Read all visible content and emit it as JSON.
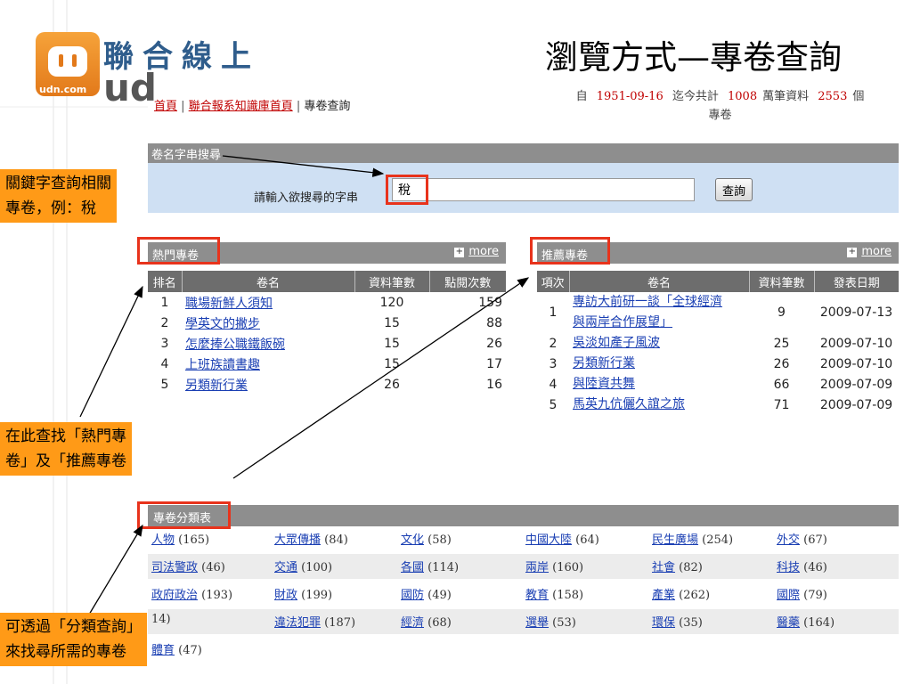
{
  "logo": {
    "text": "聯合線上",
    "com": "udn.com",
    "ud": "ud"
  },
  "slide_title": "瀏覽方式—專卷查詢",
  "breadcrumb": {
    "home": "首頁",
    "kb_home": "聯合報系知識庫首頁",
    "current": "專卷查詢",
    "sep": "|"
  },
  "stats": {
    "from_label": "自",
    "from_date": "1951-09-16",
    "total_label": "迄今共計",
    "records": "1008",
    "records_label": "萬筆資料",
    "volumes": "2553",
    "volumes_label": "個",
    "line2": "專卷"
  },
  "search": {
    "header": "卷名字串搜尋",
    "label": "請輸入欲搜尋的字串",
    "value": "稅",
    "button": "查詢"
  },
  "hot": {
    "title": "熱門專卷",
    "more": "more",
    "columns": [
      "排名",
      "卷名",
      "資料筆數",
      "點閱次數"
    ],
    "rows": [
      {
        "rank": "1",
        "name": "職場新鮮人須知",
        "count": "120",
        "views": "159"
      },
      {
        "rank": "2",
        "name": "學英文的撇步",
        "count": "15",
        "views": "88"
      },
      {
        "rank": "3",
        "name": "怎麼捧公職鐵飯碗",
        "count": "15",
        "views": "26"
      },
      {
        "rank": "4",
        "name": "上班族讀書趣",
        "count": "15",
        "views": "17"
      },
      {
        "rank": "5",
        "name": "另類新行業",
        "count": "26",
        "views": "16"
      }
    ]
  },
  "recommended": {
    "title": "推薦專卷",
    "more": "more",
    "columns": [
      "項次",
      "卷名",
      "資料筆數",
      "發表日期"
    ],
    "rows": [
      {
        "no": "1",
        "name": "專訪大前研一談「全球經濟與兩岸合作展望」",
        "count": "9",
        "date": "2009-07-13"
      },
      {
        "no": "2",
        "name": "吳淡如產子風波",
        "count": "25",
        "date": "2009-07-10"
      },
      {
        "no": "3",
        "name": "另類新行業",
        "count": "26",
        "date": "2009-07-10"
      },
      {
        "no": "4",
        "name": "與陸資共舞",
        "count": "66",
        "date": "2009-07-09"
      },
      {
        "no": "5",
        "name": "馬英九伉儷久誼之旅",
        "count": "71",
        "date": "2009-07-09"
      }
    ]
  },
  "categories": {
    "title": "專卷分類表",
    "rows": [
      [
        {
          "name": "人物",
          "count": "(165)"
        },
        {
          "name": "大眾傳播",
          "count": "(84)"
        },
        {
          "name": "文化",
          "count": "(58)"
        },
        {
          "name": "中國大陸",
          "count": "(64)"
        },
        {
          "name": "民生廣場",
          "count": "(254)"
        },
        {
          "name": "外交",
          "count": "(67)"
        }
      ],
      [
        {
          "name": "司法警政",
          "count": "(46)"
        },
        {
          "name": "交通",
          "count": "(100)"
        },
        {
          "name": "各國",
          "count": "(114)"
        },
        {
          "name": "兩岸",
          "count": "(160)"
        },
        {
          "name": "社會",
          "count": "(82)"
        },
        {
          "name": "科技",
          "count": "(46)"
        }
      ],
      [
        {
          "name": "政府政治",
          "count": "(193)"
        },
        {
          "name": "財政",
          "count": "(199)"
        },
        {
          "name": "國防",
          "count": "(49)"
        },
        {
          "name": "教育",
          "count": "(158)"
        },
        {
          "name": "產業",
          "count": "(262)"
        },
        {
          "name": "國際",
          "count": "(79)"
        }
      ],
      [
        {
          "name": "",
          "count": "14)"
        },
        {
          "name": "違法犯罪",
          "count": "(187)"
        },
        {
          "name": "經濟",
          "count": "(68)"
        },
        {
          "name": "選舉",
          "count": "(53)"
        },
        {
          "name": "環保",
          "count": "(35)"
        },
        {
          "name": "醫藥",
          "count": "(164)"
        }
      ],
      [
        {
          "name": "體育",
          "count": "(47)"
        }
      ]
    ]
  },
  "callouts": {
    "keyword": [
      "關鍵字查詢相關",
      "專卷，例：稅"
    ],
    "hot_rec": [
      "在此查找「熱門專",
      "卷」及「推薦專卷"
    ],
    "category": [
      "可透過「分類查詢」",
      "來找尋所需的專卷"
    ]
  },
  "colors": {
    "highlight": "#e8331c",
    "callout": "#ff9a17",
    "header": "#8e8e8e",
    "link": "#1a3fb3",
    "accent": "#c00000"
  }
}
